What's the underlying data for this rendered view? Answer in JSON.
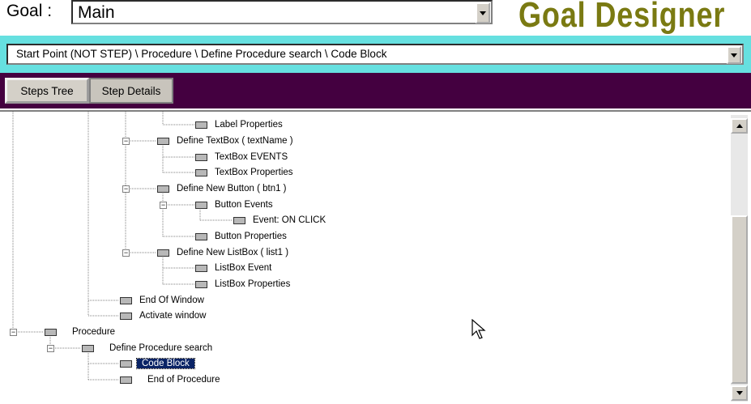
{
  "header": {
    "goal_label": "Goal :",
    "goal_value": "Main",
    "app_title": "Goal Designer"
  },
  "path_bar": {
    "value": "Start Point (NOT STEP)  \\  Procedure  \\  Define Procedure search  \\  Code Block"
  },
  "tabs": [
    {
      "label": "Steps Tree",
      "active": true
    },
    {
      "label": "Step Details",
      "active": false
    }
  ],
  "tree": {
    "nodes": [
      {
        "label": "Label Properties"
      },
      {
        "label": "Define TextBox   ( textName   )"
      },
      {
        "label": "TextBox EVENTS"
      },
      {
        "label": "TextBox Properties"
      },
      {
        "label": "Define New Button  ( btn1 )"
      },
      {
        "label": "Button Events"
      },
      {
        "label": "Event:  ON CLICK"
      },
      {
        "label": "Button Properties"
      },
      {
        "label": "Define New ListBox  ( list1 )"
      },
      {
        "label": "ListBox Event"
      },
      {
        "label": "ListBox Properties"
      },
      {
        "label": "End Of Window"
      },
      {
        "label": "Activate window"
      },
      {
        "label": "Procedure"
      },
      {
        "label": "Define Procedure search"
      },
      {
        "label": "Code Block",
        "selected": true
      },
      {
        "label": "End of Procedure"
      }
    ]
  },
  "colors": {
    "path_bar_bg": "#66e0e0",
    "tab_bar_bg": "#440040",
    "title_color": "#7a7a12",
    "selection_bg": "#0a2466"
  }
}
